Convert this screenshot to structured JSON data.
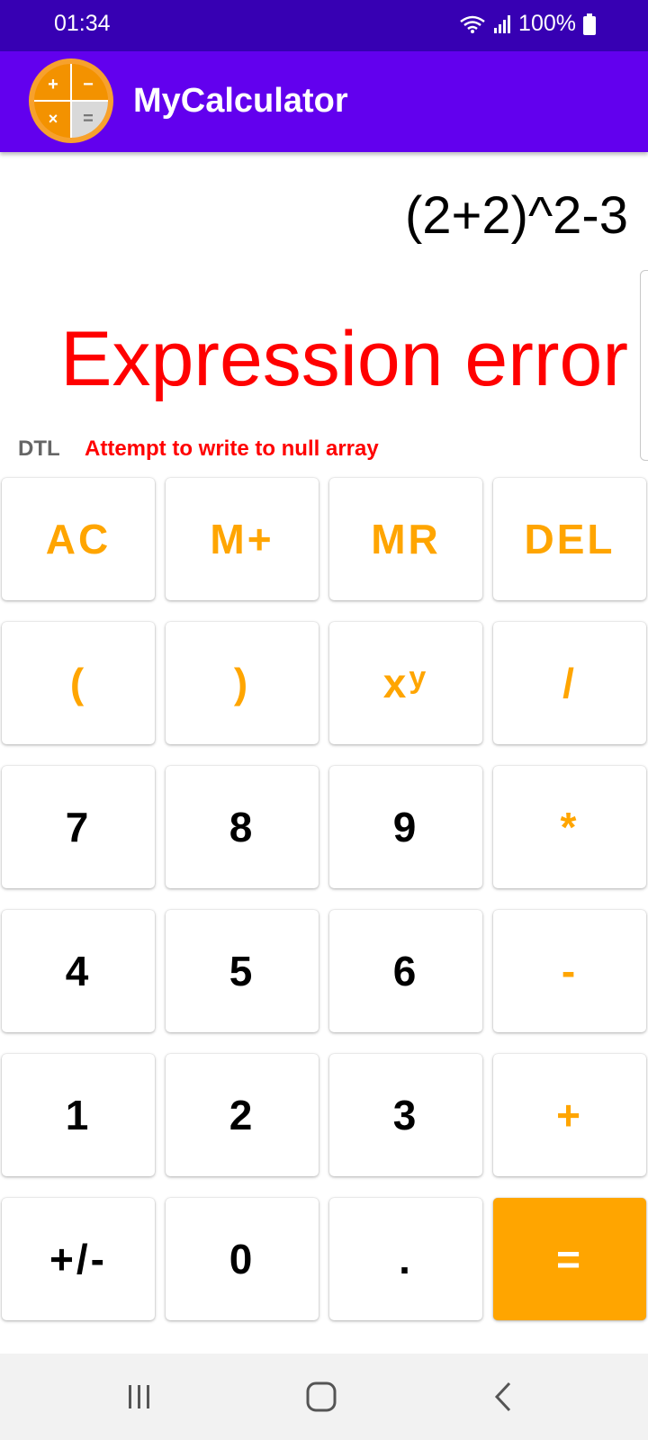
{
  "status_bar": {
    "time": "01:34",
    "battery": "100%",
    "icons": [
      "wifi-icon",
      "signal-icon",
      "battery-icon"
    ]
  },
  "app_bar": {
    "title": "MyCalculator",
    "logo": "calculator-logo-icon"
  },
  "display": {
    "expression": "(2+2)^2-3",
    "result": "Expression error",
    "mode": "DTL",
    "error_detail": "Attempt to write to null array"
  },
  "keypad": {
    "row1": [
      "AC",
      "M+",
      "MR",
      "DEL"
    ],
    "row2": [
      "(",
      ")",
      "x",
      "/"
    ],
    "power_sup": "y",
    "row3": [
      "7",
      "8",
      "9",
      "*"
    ],
    "row4": [
      "4",
      "5",
      "6",
      "-"
    ],
    "row5": [
      "1",
      "2",
      "3",
      "+"
    ],
    "row6": [
      "+/-",
      "0",
      ".",
      "="
    ]
  },
  "colors": {
    "status_bar": "#3700b3",
    "app_bar": "#6200ee",
    "accent": "#ffa500",
    "error": "#ff0000"
  },
  "nav_bar": {
    "icons": [
      "recent-apps-icon",
      "home-icon",
      "back-icon"
    ]
  }
}
